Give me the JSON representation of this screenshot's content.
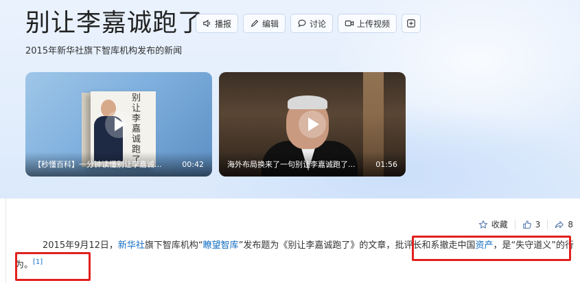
{
  "page": {
    "title": "别让李嘉诚跑了",
    "subtitle": "2015年新华社旗下智库机构发布的新闻"
  },
  "toolbar": {
    "broadcast_label": "播报",
    "edit_label": "编辑",
    "discuss_label": "讨论",
    "upload_video_label": "上传视频"
  },
  "videos": [
    {
      "title": "【秒懂百科】一分钟读懂别让李嘉诚...",
      "duration": "00:42",
      "cover_text": "别让李嘉诚跑了"
    },
    {
      "title": "海外布局换来了一句别让李嘉诚跑了...",
      "duration": "01:56"
    }
  ],
  "actions": {
    "favorite_label": "收藏",
    "like_count": "3",
    "share_count": "8"
  },
  "article": {
    "part1": "2015年9月12日，",
    "link_xinhua": "新华社",
    "part2": "旗下智库机构“",
    "link_liaowang": "瞭望智库",
    "part3": "”发布题为《别让李嘉诚跑了》的文章，",
    "part4": "批评长和系撤走中国",
    "link_assets": "资产",
    "part5": "，是“失守道义”的行为。",
    "ref": "[1]"
  },
  "colors": {
    "accent_link": "#136ec2",
    "highlight_box": "#e0201e"
  }
}
